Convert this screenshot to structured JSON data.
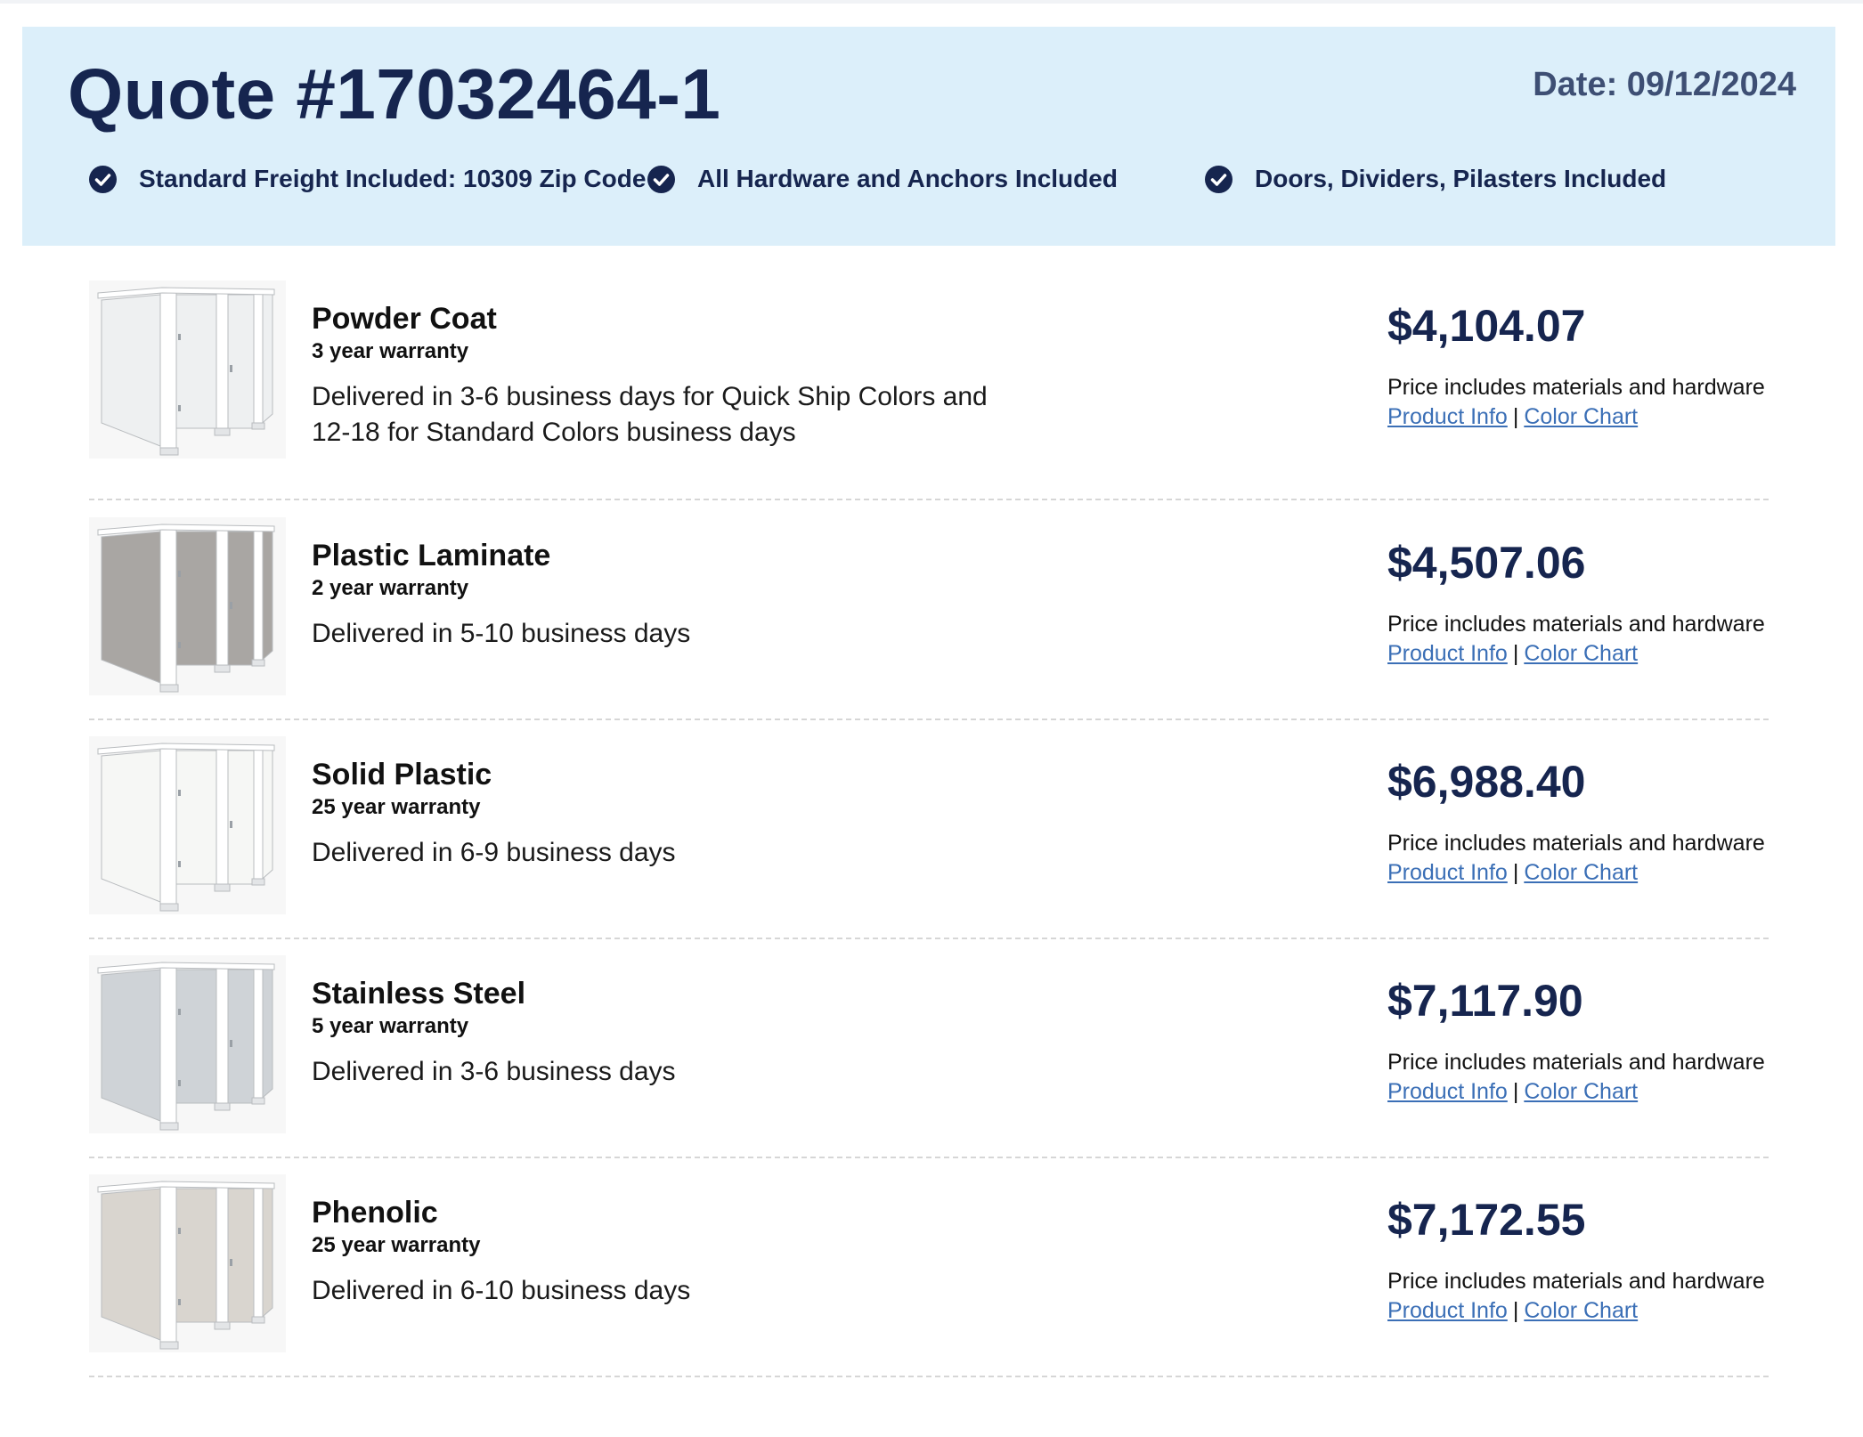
{
  "header": {
    "title": "Quote #17032464-1",
    "date": "Date: 09/12/2024",
    "features": [
      "Standard Freight Included: 10309 Zip Code",
      "All Hardware and Anchors Included",
      "Doors, Dividers, Pilasters Included"
    ]
  },
  "products": [
    {
      "name": "Powder Coat",
      "warranty": "3 year warranty",
      "delivery": "Delivered in 3-6 business days for Quick Ship Colors and 12-18 for Standard Colors business days",
      "price": "$4,104.07",
      "note": "Price includes materials and hardware",
      "link_info": "Product Info",
      "link_sep": "|",
      "link_color": "Color Chart",
      "panel_color": "#eef0f1"
    },
    {
      "name": "Plastic Laminate",
      "warranty": "2 year warranty",
      "delivery": "Delivered in 5-10 business days",
      "price": "$4,507.06",
      "note": "Price includes materials and hardware",
      "link_info": "Product Info",
      "link_sep": "|",
      "link_color": "Color Chart",
      "panel_color": "#a9a6a3"
    },
    {
      "name": "Solid Plastic",
      "warranty": "25 year warranty",
      "delivery": "Delivered in 6-9 business days",
      "price": "$6,988.40",
      "note": "Price includes materials and hardware",
      "link_info": "Product Info",
      "link_sep": "|",
      "link_color": "Color Chart",
      "panel_color": "#f6f7f5"
    },
    {
      "name": "Stainless Steel",
      "warranty": "5 year warranty",
      "delivery": "Delivered in 3-6 business days",
      "price": "$7,117.90",
      "note": "Price includes materials and hardware",
      "link_info": "Product Info",
      "link_sep": "|",
      "link_color": "Color Chart",
      "panel_color": "#cfd3d7"
    },
    {
      "name": "Phenolic",
      "warranty": "25 year warranty",
      "delivery": "Delivered in 6-10 business days",
      "price": "$7,172.55",
      "note": "Price includes materials and hardware",
      "link_info": "Product Info",
      "link_sep": "|",
      "link_color": "Color Chart",
      "panel_color": "#d9d5cf"
    }
  ],
  "colors": {
    "navy": "#16254f",
    "header_bg": "#dceffa",
    "link": "#3b6fb6"
  },
  "icons": {
    "feature": "check-circle-icon",
    "thumbnail": "toilet-partition-image"
  }
}
